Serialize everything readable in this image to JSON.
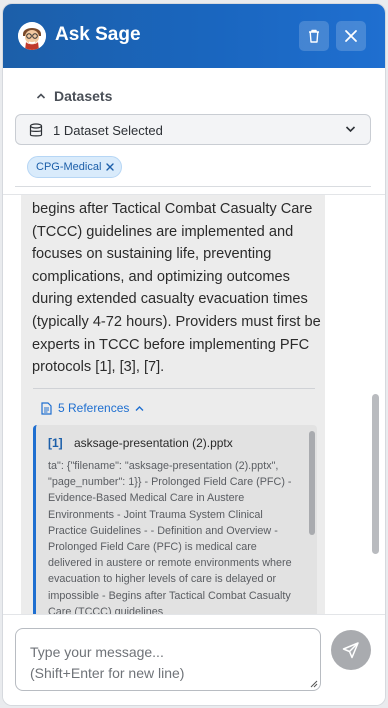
{
  "header": {
    "title": "Ask Sage",
    "avatar_icon": "sage-avatar-icon",
    "color": "#1a66bf"
  },
  "datasets": {
    "toggle_label": "Datasets",
    "select_text": "1 Dataset Selected",
    "chips": [
      {
        "label": "CPG-Medical"
      }
    ]
  },
  "message": {
    "text": "begins after Tactical Combat Casualty Care (TCCC) guidelines are implemented and focuses on sustaining life, preventing complications, and optimizing outcomes during extended casualty evacuation times (typically 4-72 hours). Providers must first be experts in TCCC before implementing PFC protocols [1], [3], [7]."
  },
  "references": {
    "toggle_label": "5 References",
    "items": [
      {
        "number": "[1]",
        "filename": "asksage-presentation (2).pptx",
        "content": "ta\": {\"filename\": \"asksage-presentation (2).pptx\", \"page_number\": 1}} - Prolonged Field Care (PFC) - Evidence-Based Medical Care in Austere Environments - Joint Trauma System Clinical Practice Guidelines - - Definition and Overview - Prolonged Field Care (PFC) is medical care delivered in austere or remote environments where evacuation to higher levels of care is delayed or impossible - Begins after Tactical Combat Casualty Care (TCCC) guidelines"
      }
    ]
  },
  "composer": {
    "placeholder": "Type your message...\n(Shift+Enter for new line)"
  }
}
